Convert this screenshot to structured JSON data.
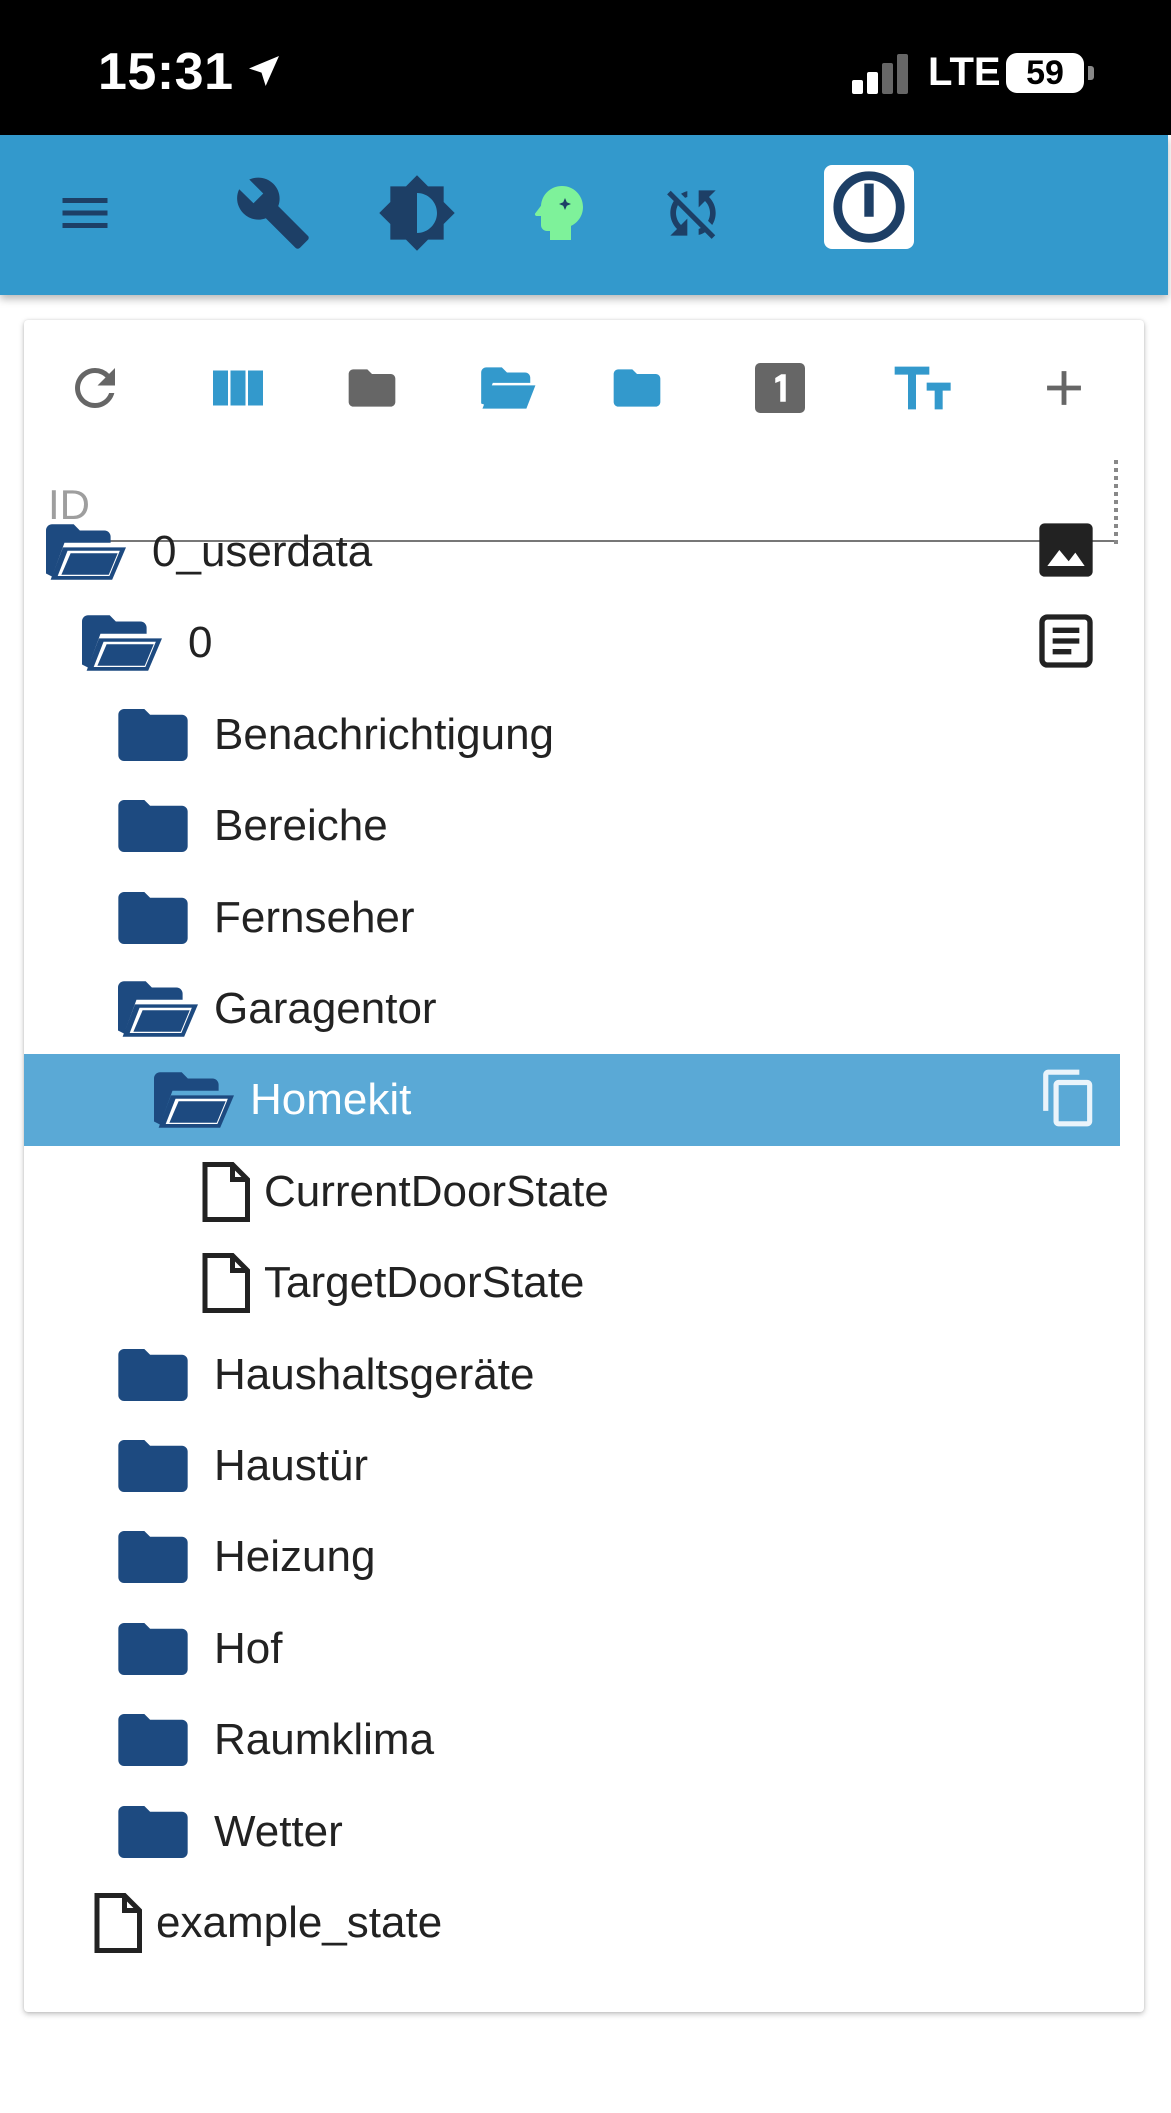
{
  "status_bar": {
    "time": "15:31",
    "network": "LTE",
    "battery": "59"
  },
  "app_bar": {
    "icons": [
      "menu-icon",
      "wrench-icon",
      "brightness-icon",
      "head-icon",
      "sync-disabled-icon",
      "iobroker-logo"
    ],
    "colors": {
      "bar": "#3399cc",
      "head": "#7ef29a",
      "dark": "#1d3f66"
    }
  },
  "toolbar": {
    "icons": [
      "refresh-icon",
      "columns-icon",
      "folder-icon",
      "folder-open-icon",
      "folder-icon",
      "one-box-icon",
      "text-size-icon",
      "plus-icon"
    ]
  },
  "search": {
    "placeholder": "ID",
    "value": ""
  },
  "tree": {
    "items": [
      {
        "label": "0_userdata",
        "icon": "folder-open-icon",
        "depth": 0,
        "action": "image-icon"
      },
      {
        "label": "0",
        "icon": "folder-open-icon",
        "depth": 1,
        "action": "document-icon"
      },
      {
        "label": "Benachrichtigung",
        "icon": "folder-icon",
        "depth": 2
      },
      {
        "label": "Bereiche",
        "icon": "folder-icon",
        "depth": 2
      },
      {
        "label": "Fernseher",
        "icon": "folder-icon",
        "depth": 2
      },
      {
        "label": "Garagentor",
        "icon": "folder-open-icon",
        "depth": 2
      },
      {
        "label": "Homekit",
        "icon": "folder-open-icon",
        "depth": 3,
        "selected": true,
        "action": "copy-icon"
      },
      {
        "label": "CurrentDoorState",
        "icon": "file-icon",
        "depth": 4
      },
      {
        "label": "TargetDoorState",
        "icon": "file-icon",
        "depth": 4
      },
      {
        "label": "Haushaltsgeräte",
        "icon": "folder-icon",
        "depth": 2
      },
      {
        "label": "Haustür",
        "icon": "folder-icon",
        "depth": 2
      },
      {
        "label": "Heizung",
        "icon": "folder-icon",
        "depth": 2
      },
      {
        "label": "Hof",
        "icon": "folder-icon",
        "depth": 2
      },
      {
        "label": "Raumklima",
        "icon": "folder-icon",
        "depth": 2
      },
      {
        "label": "Wetter",
        "icon": "folder-icon",
        "depth": 2
      },
      {
        "label": "example_state",
        "icon": "file-icon",
        "depth": 1
      }
    ],
    "colors": {
      "folder": "#1d4a80",
      "selected_row": "#5aa9d6"
    }
  }
}
